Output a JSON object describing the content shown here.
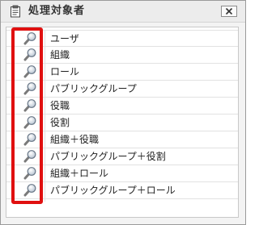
{
  "dialog": {
    "title": "処理対象者",
    "title_icon": "clipboard-icon",
    "close_icon": "close-icon"
  },
  "list": {
    "row_icon": "magnifier-icon",
    "items": [
      {
        "label": "ユーザ"
      },
      {
        "label": "組織"
      },
      {
        "label": "ロール"
      },
      {
        "label": "パブリックグループ"
      },
      {
        "label": "役職"
      },
      {
        "label": "役割"
      },
      {
        "label": "組織＋役職"
      },
      {
        "label": "パブリックグループ＋役割"
      },
      {
        "label": "組織＋ロール"
      },
      {
        "label": "パブリックグループ＋ロール"
      }
    ]
  },
  "annotation": {
    "highlight_color": "#e01010"
  }
}
